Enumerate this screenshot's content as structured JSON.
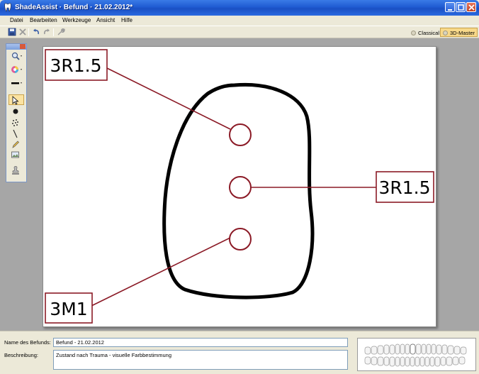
{
  "window": {
    "title": "ShadeAssist · Befund · 21.02.2012*",
    "accent_color": "#1f5bd2"
  },
  "menu": {
    "items": [
      "Datei",
      "Bearbeiten",
      "Werkzeuge",
      "Ansicht",
      "Hilfe"
    ]
  },
  "toolbar": {
    "icons": [
      "save-icon",
      "delete-icon",
      "undo-icon",
      "redo-icon",
      "tools-icon"
    ],
    "mode_classical": "Classical",
    "mode_3dmaster": "3D-Master",
    "active_mode": "3D-Master"
  },
  "tool_palette": {
    "tools": [
      "zoom-icon",
      "color-wheel-icon",
      "line-width-icon",
      "select-arrow-icon",
      "circle-dot-icon",
      "spray-icon",
      "line-icon",
      "pen-icon",
      "image-icon",
      "stamp-icon"
    ],
    "selected_tool": "select-arrow-icon"
  },
  "canvas": {
    "stroke_color": "#8b1a26",
    "labels": {
      "top_left": "3R1.5",
      "middle_right": "3R1.5",
      "bottom_left": "3M1"
    }
  },
  "form": {
    "name_label": "Name des Befunds:",
    "name_value": "Befund - 21.02.2012",
    "description_label": "Beschreibung:",
    "description_value": "Zustand nach Trauma - visuelle Farbbestimmung"
  }
}
